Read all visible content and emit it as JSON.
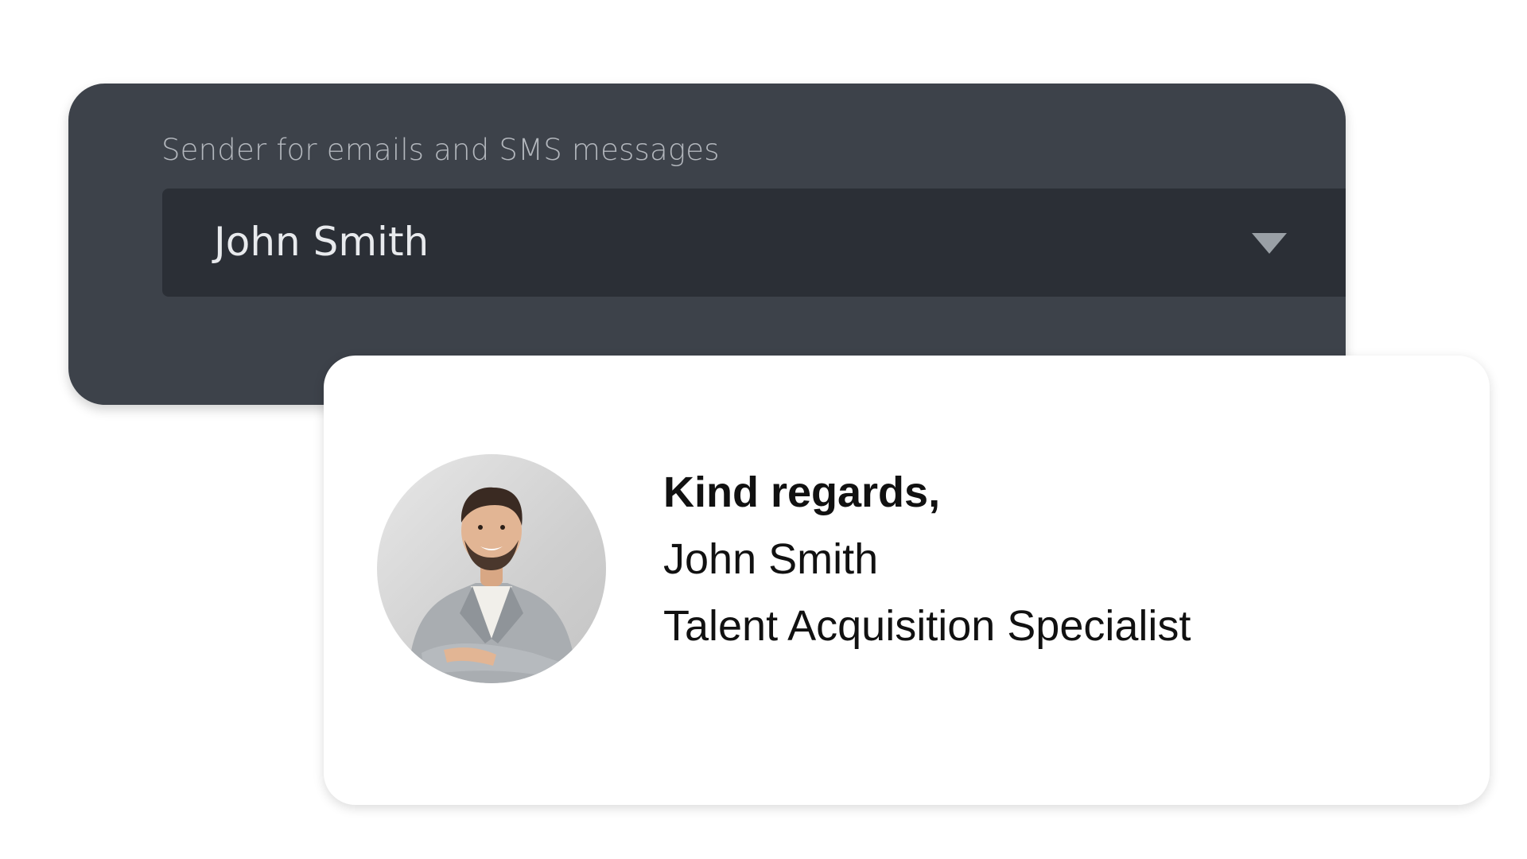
{
  "sender_settings": {
    "label": "Sender for emails and SMS messages",
    "selected_sender": "John Smith"
  },
  "signature_preview": {
    "greeting": "Kind regards,",
    "name": "John Smith",
    "job_title": "Talent Acquisition Specialist"
  },
  "icons": {
    "dropdown": "chevron-down-icon",
    "avatar": "avatar"
  },
  "colors": {
    "card_dark": "#3d424a",
    "select_dark": "#2b2f36",
    "label_gray": "#b3b7bd",
    "value_light": "#e8eaed",
    "signature_text": "#111111"
  }
}
